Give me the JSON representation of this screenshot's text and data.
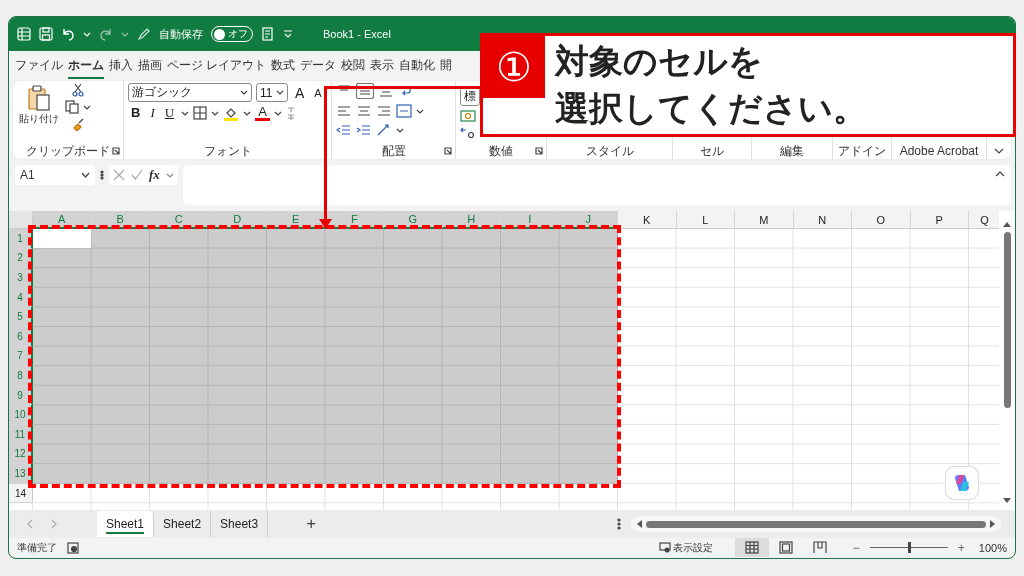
{
  "title_bar": {
    "autosave_label": "自動保存",
    "autosave": {
      "on": false,
      "label": "オフ"
    },
    "title": "Book1 - Excel"
  },
  "menu_tabs": [
    {
      "label": "ファイル",
      "selected": false
    },
    {
      "label": "ホーム",
      "selected": true
    },
    {
      "label": "挿入",
      "selected": false
    },
    {
      "label": "描画",
      "selected": false
    },
    {
      "label": "ページ レイアウト",
      "selected": false
    },
    {
      "label": "数式",
      "selected": false
    },
    {
      "label": "データ",
      "selected": false
    },
    {
      "label": "校閲",
      "selected": false
    },
    {
      "label": "表示",
      "selected": false
    },
    {
      "label": "自動化",
      "selected": false
    },
    {
      "label": "開",
      "selected": false
    }
  ],
  "ribbon": {
    "groups": [
      {
        "kind": "clipboard",
        "label": "クリップボード",
        "dialog_launcher": true,
        "paste_label": "貼り付け"
      },
      {
        "kind": "font",
        "label": "フォント",
        "dialog_launcher": false,
        "font_name": "游ゴシック",
        "font_size": "11",
        "grow_glyph": "A",
        "shrink_glyph": "A",
        "bold_glyph": "B",
        "italic_glyph": "I",
        "underline_glyph": "U",
        "color_glyph": "A"
      },
      {
        "kind": "alignment",
        "label": "配置",
        "dialog_launcher": true
      },
      {
        "kind": "number",
        "label": "数値",
        "dialog_launcher": true,
        "format": "標"
      },
      {
        "kind": "style",
        "label": "スタイル",
        "dialog_launcher": false
      },
      {
        "kind": "cells",
        "label": "セル",
        "dialog_launcher": false
      },
      {
        "kind": "editing",
        "label": "編集",
        "dialog_launcher": false
      },
      {
        "kind": "addins",
        "label": "アドイン",
        "dialog_launcher": false
      },
      {
        "kind": "acrobat",
        "label": "Adobe Acrobat",
        "dialog_launcher": false
      }
    ]
  },
  "formula_bar": {
    "name_box": "A1",
    "fx": "fx"
  },
  "sheet": {
    "columns": [
      {
        "label": "A",
        "selected": true
      },
      {
        "label": "B",
        "selected": true
      },
      {
        "label": "C",
        "selected": true
      },
      {
        "label": "D",
        "selected": true
      },
      {
        "label": "E",
        "selected": true
      },
      {
        "label": "F",
        "selected": true
      },
      {
        "label": "G",
        "selected": true
      },
      {
        "label": "H",
        "selected": true
      },
      {
        "label": "I",
        "selected": true
      },
      {
        "label": "J",
        "selected": true
      },
      {
        "label": "K",
        "selected": false
      },
      {
        "label": "L",
        "selected": false
      },
      {
        "label": "M",
        "selected": false
      },
      {
        "label": "N",
        "selected": false
      },
      {
        "label": "O",
        "selected": false
      },
      {
        "label": "P",
        "selected": false
      },
      {
        "label": "Q",
        "selected": false
      }
    ],
    "rows": [
      {
        "label": "1",
        "selected": true
      },
      {
        "label": "2",
        "selected": true
      },
      {
        "label": "3",
        "selected": true
      },
      {
        "label": "4",
        "selected": true
      },
      {
        "label": "5",
        "selected": true
      },
      {
        "label": "6",
        "selected": true
      },
      {
        "label": "7",
        "selected": true
      },
      {
        "label": "8",
        "selected": true
      },
      {
        "label": "9",
        "selected": true
      },
      {
        "label": "10",
        "selected": true
      },
      {
        "label": "11",
        "selected": true
      },
      {
        "label": "12",
        "selected": true
      },
      {
        "label": "13",
        "selected": true
      },
      {
        "label": "14",
        "selected": false
      }
    ]
  },
  "sheet_tabs": [
    {
      "label": "Sheet1",
      "selected": true
    },
    {
      "label": "Sheet2",
      "selected": false
    },
    {
      "label": "Sheet3",
      "selected": false
    }
  ],
  "add_sheet": "+",
  "status_bar": {
    "status": "準備完了",
    "display_settings": "表示設定",
    "views": [
      {
        "kind": "normal",
        "selected": true
      },
      {
        "kind": "page_layout",
        "selected": false
      },
      {
        "kind": "page_break",
        "selected": false
      }
    ],
    "zoom": {
      "level": 0.5
    },
    "zoom_label": "100%",
    "zoom_out": "−",
    "zoom_in": "+"
  },
  "callout": {
    "number": "①",
    "lines": [
      "対象のセルを",
      "選択してください。"
    ]
  }
}
